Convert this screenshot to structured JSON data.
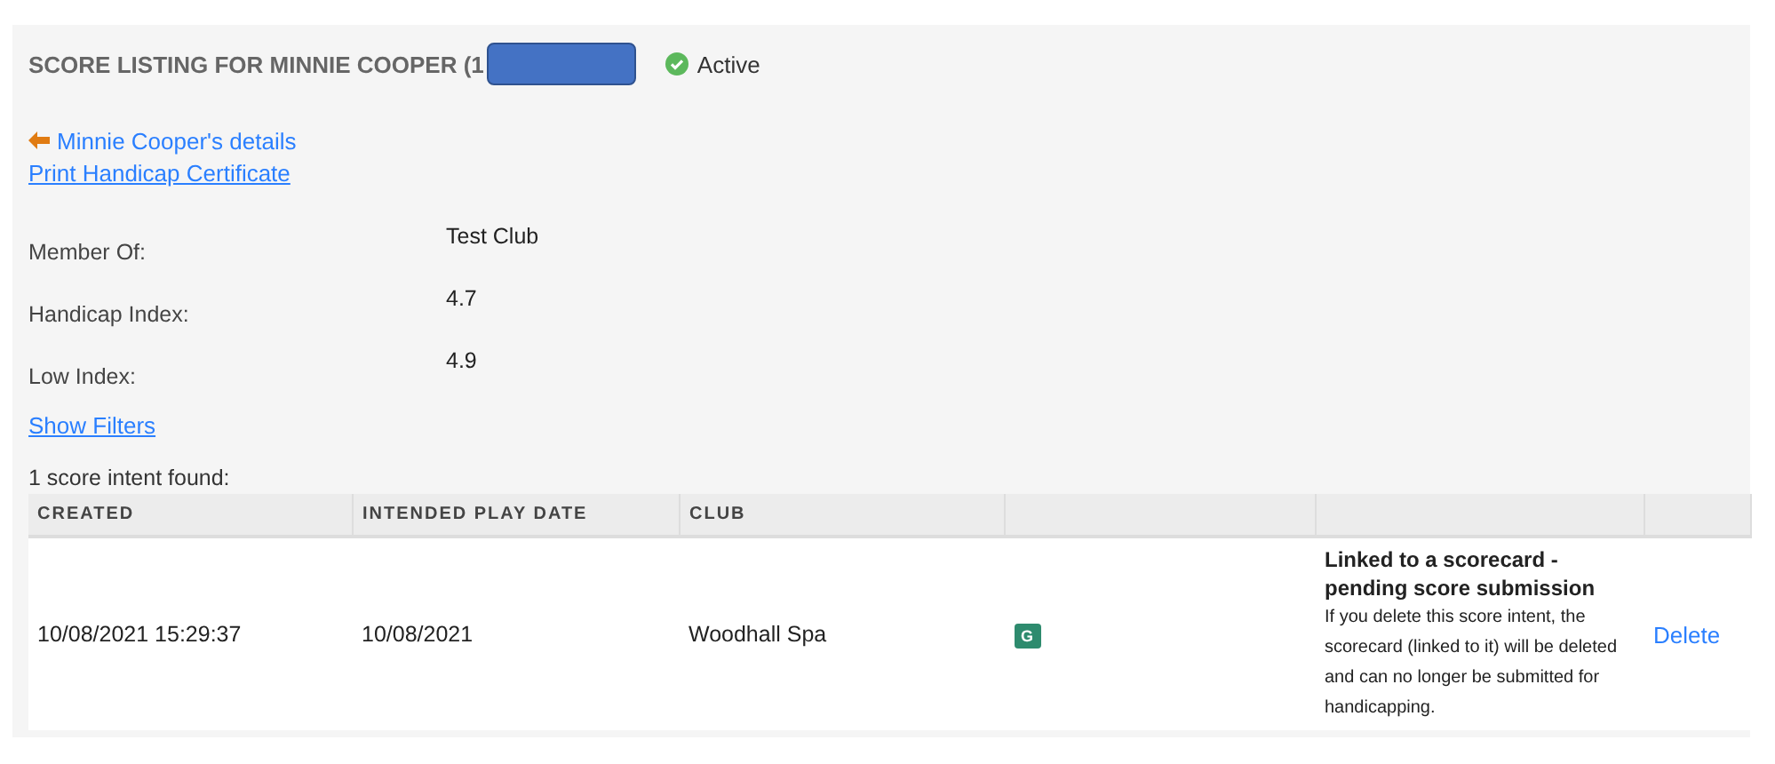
{
  "header": {
    "title": "SCORE LISTING FOR MINNIE COOPER (1",
    "redacted": true,
    "status": {
      "label": "Active",
      "active": true
    }
  },
  "links": [
    {
      "kind": "back",
      "label": "Minnie Cooper's details"
    },
    {
      "kind": "plain",
      "label": "Print Handicap Certificate"
    }
  ],
  "details": [
    {
      "label": "Member Of:",
      "value": "Test Club"
    },
    {
      "label": "Handicap Index:",
      "value": "4.7"
    },
    {
      "label": "Low Index:",
      "value": "4.9"
    }
  ],
  "filters_link": "Show Filters",
  "result_count": "1 score intent found:",
  "table": {
    "columns": [
      "CREATED",
      "INTENDED PLAY DATE",
      "CLUB",
      "",
      ""
    ],
    "rows": [
      {
        "created": "10/08/2021 15:29:37",
        "play_date": "10/08/2021",
        "club": "Woodhall Spa",
        "badge": "G",
        "status_title": "Linked to a scorecard - pending score submission",
        "status_text": "If you delete this score intent, the scorecard (linked to it) will be deleted and can no longer be submitted for handicapping.",
        "action": "Delete"
      }
    ]
  }
}
